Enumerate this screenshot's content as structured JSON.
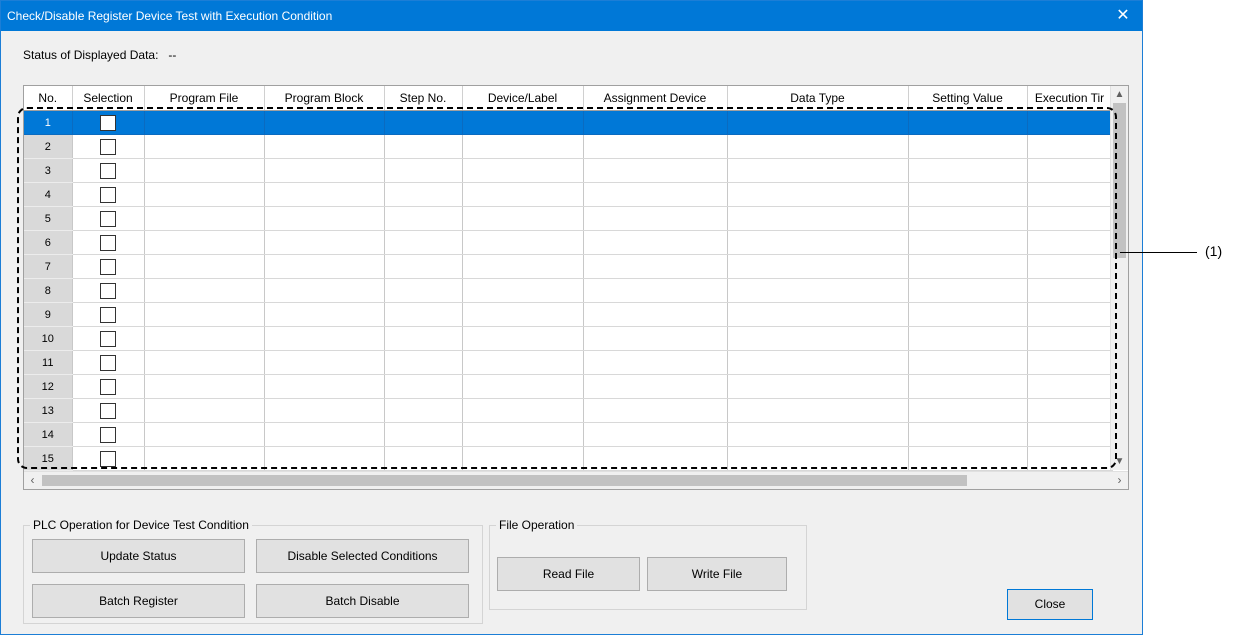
{
  "window": {
    "title": "Check/Disable Register Device Test with Execution Condition"
  },
  "status": {
    "label": "Status of Displayed Data:",
    "value": "--"
  },
  "table": {
    "columns": [
      "No.",
      "Selection",
      "Program File",
      "Program Block",
      "Step No.",
      "Device/Label",
      "Assignment Device",
      "Data Type",
      "Setting Value",
      "Execution Tir"
    ],
    "rows": [
      "1",
      "2",
      "3",
      "4",
      "5",
      "6",
      "7",
      "8",
      "9",
      "10",
      "11",
      "12",
      "13",
      "14",
      "15"
    ],
    "selected_row": "1"
  },
  "callout": {
    "label": "(1)"
  },
  "plc_group": {
    "title": "PLC Operation for Device Test Condition",
    "update_status": "Update Status",
    "disable_selected": "Disable Selected Conditions",
    "batch_register": "Batch Register",
    "batch_disable": "Batch Disable"
  },
  "file_group": {
    "title": "File Operation",
    "read_file": "Read File",
    "write_file": "Write File"
  },
  "close_button": "Close",
  "colors": {
    "titlebar": "#0078d7",
    "selection": "#0078d7",
    "window_bg": "#f0f0f0"
  }
}
